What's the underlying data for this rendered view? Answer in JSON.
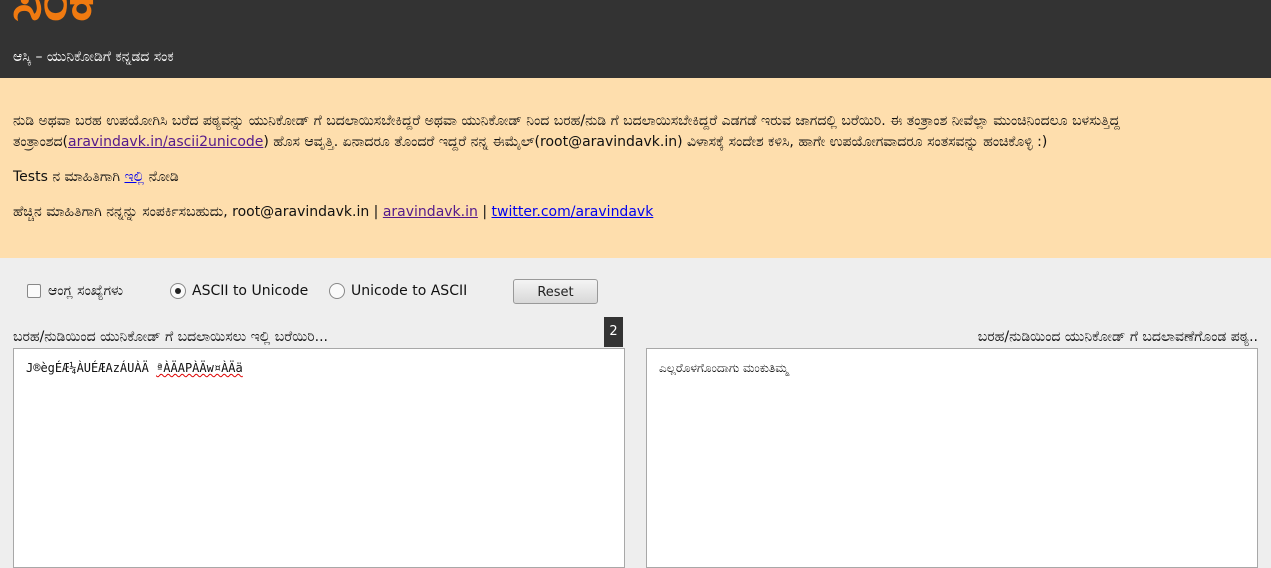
{
  "header": {
    "logo": "ಸಂಕ",
    "tagline": "ಆಸ್ಕಿ – ಯುನಿಕೋಡಿಗೆ ಕನ್ನಡದ ಸಂಕ"
  },
  "info": {
    "p1_before": "ನುಡಿ ಅಥವಾ ಬರಹ ಉಪಯೋಗಿಸಿ ಬರೆದ ಪಠ್ಯವನ್ನು ಯುನಿಕೋಡ್ ಗೆ ಬದಲಾಯಿಸಬೇಕಿದ್ದರೆ ಅಥವಾ ಯುನಿಕೋಡ್ ನಿಂದ ಬರಹ/ನುಡಿ ಗೆ ಬದಲಾಯಿಸಬೇಕಿದ್ದರೆ ಎಡಗಡೆ ಇರುವ ಜಾಗದಲ್ಲಿ ಬರೆಯಿರಿ. ಈ ತಂತ್ರಾಂಶ ನೀವೆಲ್ಲಾ ಮುಂಚಿನಿಂದಲೂ ಬಳಸುತ್ತಿದ್ದ ತಂತ್ರಾಂಶದ(",
    "p1_link": "aravindavk.in/ascii2unicode",
    "p1_after": ") ಹೊಸ ಆವೃತ್ತಿ. ಏನಾದರೂ ತೊಂದರೆ ಇದ್ದರೆ ನನ್ನ ಈಮೈಲ್(root@aravindavk.in) ವಿಳಾಸಕ್ಕೆ ಸಂದೇಶ ಕಳಿಸಿ, ಹಾಗೇ ಉಪಯೋಗವಾದರೂ ಸಂತಸವನ್ನು ಹಂಚಿಕೊಳ್ಳಿ :)",
    "p2_before": "Tests ನ ಮಾಹಿತಿಗಾಗಿ ",
    "p2_link": "ಇಲ್ಲಿ",
    "p2_after": " ನೋಡಿ",
    "p3_before": "ಹೆಚ್ಚಿನ ಮಾಹಿತಿಗಾಗಿ ನನ್ನನ್ನು ಸಂಪರ್ಕಿಸಬಹುದು, root@aravindavk.in | ",
    "p3_link1": "aravindavk.in",
    "p3_sep": " | ",
    "p3_link2": "twitter.com/aravindavk"
  },
  "controls": {
    "checkbox_label": "ಆಂಗ್ಲ ಸಂಖ್ಯೆಗಳು",
    "radio_ascii_label": "ASCII to Unicode",
    "radio_unicode_label": "Unicode to ASCII",
    "selected_mode": "ASCII to Unicode",
    "reset_label": "Reset"
  },
  "editor": {
    "left_label": "ಬರಹ/ನುಡಿಯಿಂದ ಯುನಿಕೋಡ್ ಗೆ ಬದಲಾಯಿಸಲು ಇಲ್ಲಿ ಬರೆಯಿರಿ...",
    "right_label": "ಬರಹ/ನುಡಿಯಿಂದ ಯುನಿಕೋಡ್ ಗೆ ಬದಲಾವಣೆಗೊಂಡ ಪಠ್ಯ..",
    "word_count": "2",
    "left_value_word1": "J®ègÉÆ¼ÀUÉÆAzÁUÀÄ",
    "left_value_word2": "ªÀÄAPÀÄw¤ÀÄä",
    "right_value": "ಎಲ್ಲರೊಳಗೊಂದಾಗು ಮಂಕುತಿಮ್ಮ"
  },
  "colors": {
    "header_bg": "#333333",
    "logo": "#f07a10",
    "info_bg": "#fedead",
    "page_bg": "#eeeeee"
  }
}
